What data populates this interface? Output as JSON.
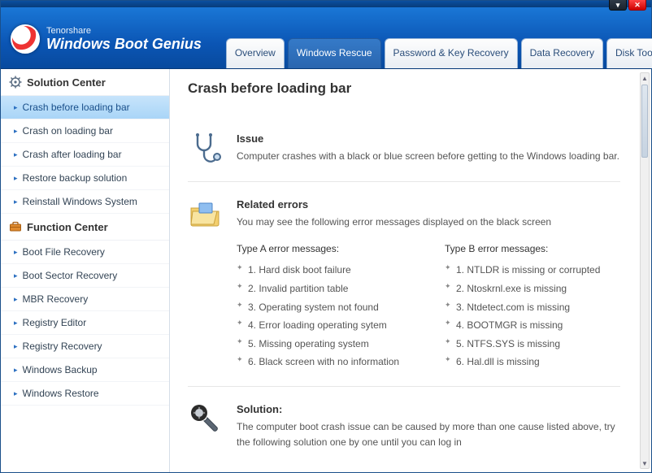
{
  "brand": {
    "small": "Tenorshare",
    "big": "Windows Boot Genius"
  },
  "tabs": [
    {
      "label": "Overview"
    },
    {
      "label": "Windows Rescue",
      "active": true
    },
    {
      "label": "Password & Key Recovery"
    },
    {
      "label": "Data Recovery"
    },
    {
      "label": "Disk Tools"
    }
  ],
  "sidebar": {
    "solution_head": "Solution Center",
    "function_head": "Function Center",
    "solution_items": [
      "Crash before loading bar",
      "Crash on loading bar",
      "Crash after loading bar",
      "Restore backup solution",
      "Reinstall Windows System"
    ],
    "function_items": [
      "Boot File Recovery",
      "Boot Sector Recovery",
      "MBR Recovery",
      "Registry Editor",
      "Registry Recovery",
      "Windows Backup",
      "Windows Restore"
    ],
    "selected": "Crash before loading bar"
  },
  "page": {
    "title": "Crash before loading bar",
    "issue": {
      "title": "Issue",
      "text": "Computer crashes with a black or blue screen before getting to the Windows loading bar."
    },
    "related": {
      "title": "Related errors",
      "text": "You may see the following error messages displayed on the black screen",
      "colA_title": "Type A error messages:",
      "colB_title": "Type B error messages:",
      "colA": [
        "1. Hard disk boot failure",
        "2. Invalid partition table",
        "3. Operating system not found",
        "4. Error loading operating sytem",
        "5. Missing operating system",
        "6. Black screen with no information"
      ],
      "colB": [
        "1. NTLDR is missing or corrupted",
        "2. Ntoskrnl.exe is missing",
        "3. Ntdetect.com is missing",
        "4. BOOTMGR is missing",
        "5. NTFS.SYS is missing",
        "6. Hal.dll is missing"
      ]
    },
    "solution": {
      "title": "Solution:",
      "text": "The computer boot crash issue can be caused by more than one cause listed above, try the following solution one by one until you can log in"
    }
  }
}
